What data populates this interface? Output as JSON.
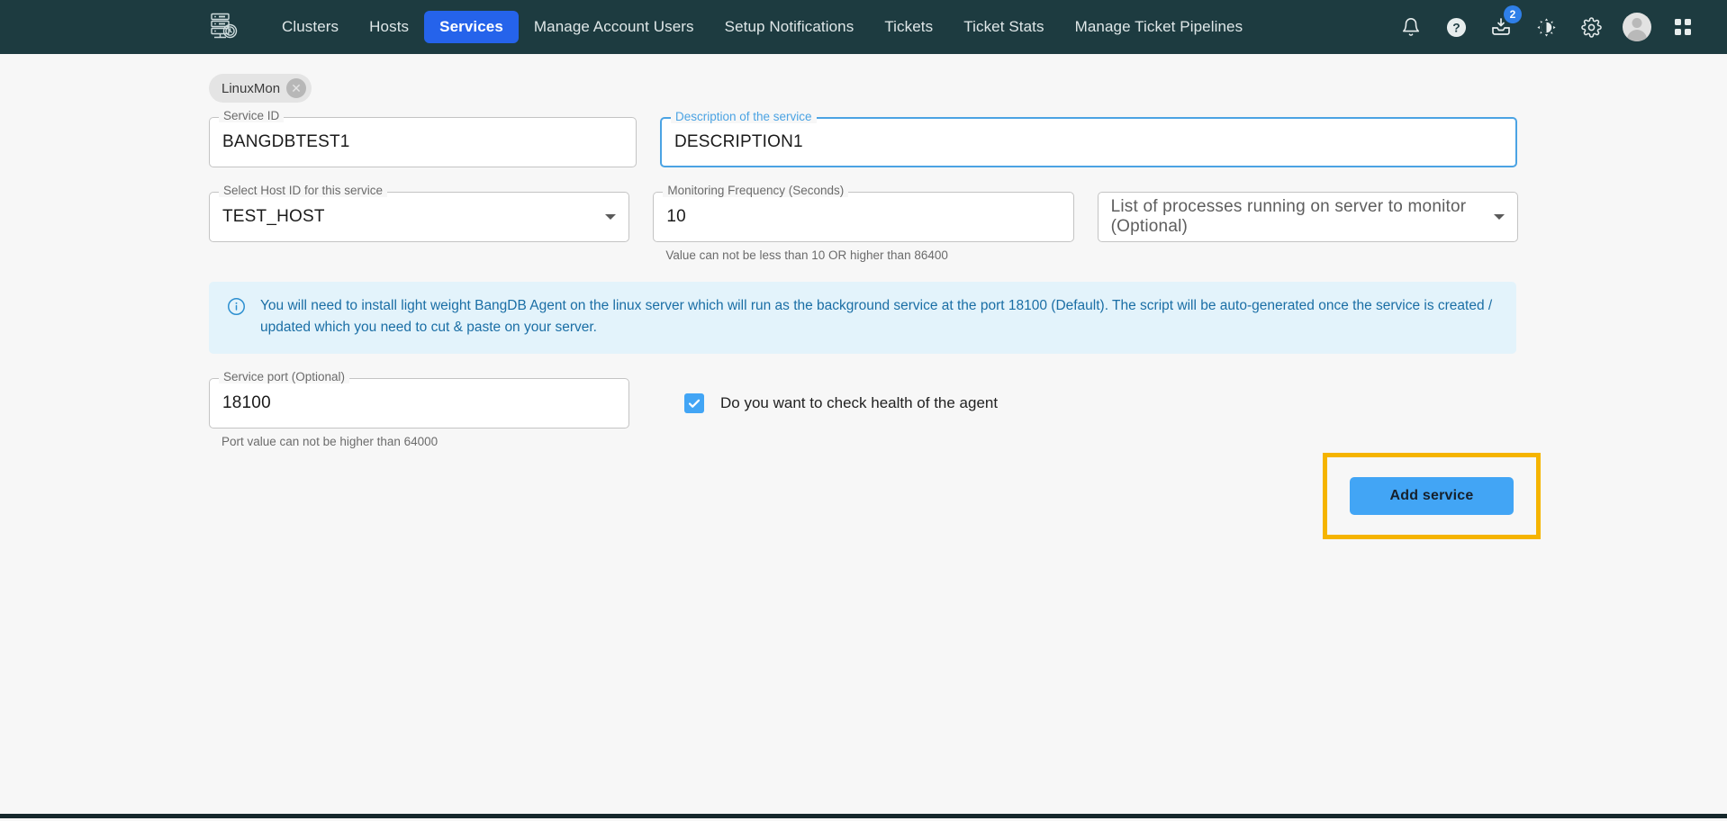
{
  "navbar": {
    "logo_icon": "server-rack-gauge-logo",
    "items": [
      {
        "label": "Clusters",
        "active": false
      },
      {
        "label": "Hosts",
        "active": false
      },
      {
        "label": "Services",
        "active": true
      },
      {
        "label": "Manage Account Users",
        "active": false
      },
      {
        "label": "Setup Notifications",
        "active": false
      },
      {
        "label": "Tickets",
        "active": false
      },
      {
        "label": "Ticket Stats",
        "active": false
      },
      {
        "label": "Manage Ticket Pipelines",
        "active": false
      }
    ],
    "icons": [
      {
        "name": "bell-icon",
        "badge": null
      },
      {
        "name": "help-circle-icon",
        "badge": null
      },
      {
        "name": "inbox-download-icon",
        "badge": "2"
      },
      {
        "name": "dark-mode-icon",
        "badge": null
      },
      {
        "name": "gear-icon",
        "badge": null
      },
      {
        "name": "avatar",
        "badge": null
      },
      {
        "name": "apps-grid-icon",
        "badge": null
      }
    ],
    "colors": {
      "background": "#1d3b40",
      "active_tab": "#2563eb",
      "badge": "#2f7fe8"
    }
  },
  "form": {
    "chip": {
      "label": "LinuxMon",
      "close_icon": "close-icon"
    },
    "service_id": {
      "label": "Service ID",
      "value": "BANGDBTEST1",
      "focused": false
    },
    "description": {
      "label": "Description of the service",
      "value": "DESCRIPTION1",
      "focused": true
    },
    "host_select": {
      "label": "Select Host ID for this service",
      "value": "TEST_HOST",
      "caret_icon": "chevron-down-icon"
    },
    "monitoring_frequency": {
      "label": "Monitoring Frequency (Seconds)",
      "value": "10",
      "helper": "Value can not be less than 10 OR higher than 86400"
    },
    "process_select": {
      "placeholder": "List of processes running on server to monitor (Optional)",
      "value": "",
      "caret_icon": "chevron-down-icon"
    },
    "banner": {
      "icon": "info-circle-icon",
      "text": "You will need to install light weight BangDB Agent on the linux server which will run as the background service at the port 18100 (Default). The script will be auto-generated once the service is created / updated which you need to cut & paste on your server.",
      "color": "#1a6ea5",
      "background": "#e3f3fb"
    },
    "service_port": {
      "label": "Service port (Optional)",
      "value": "18100",
      "helper": "Port value can not be higher than 64000"
    },
    "health_check": {
      "label": "Do you want to check health of the agent",
      "checked": true,
      "color": "#42a5f5"
    },
    "submit": {
      "label": "Add service",
      "color": "#42a5f5",
      "highlight_color": "#f5b400"
    }
  }
}
